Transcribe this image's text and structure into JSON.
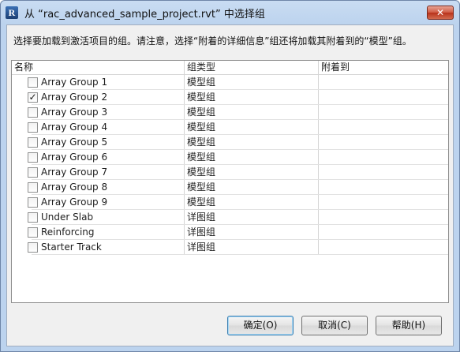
{
  "window": {
    "title": "从 “rac_advanced_sample_project.rvt” 中选择组",
    "app_icon_letter": "R",
    "close_glyph": "✕"
  },
  "instruction": "选择要加载到激活项目的组。请注意，选择“附着的详细信息”组还将加载其附着到的“模型”组。",
  "table": {
    "columns": [
      "名称",
      "组类型",
      "附着到"
    ],
    "rows": [
      {
        "name": "Array Group 1",
        "type": "模型组",
        "attached": "",
        "checked": false
      },
      {
        "name": "Array Group 2",
        "type": "模型组",
        "attached": "",
        "checked": true
      },
      {
        "name": "Array Group 3",
        "type": "模型组",
        "attached": "",
        "checked": false
      },
      {
        "name": "Array Group 4",
        "type": "模型组",
        "attached": "",
        "checked": false
      },
      {
        "name": "Array Group 5",
        "type": "模型组",
        "attached": "",
        "checked": false
      },
      {
        "name": "Array Group 6",
        "type": "模型组",
        "attached": "",
        "checked": false
      },
      {
        "name": "Array Group 7",
        "type": "模型组",
        "attached": "",
        "checked": false
      },
      {
        "name": "Array Group 8",
        "type": "模型组",
        "attached": "",
        "checked": false
      },
      {
        "name": "Array Group 9",
        "type": "模型组",
        "attached": "",
        "checked": false
      },
      {
        "name": "Under Slab",
        "type": "详图组",
        "attached": "",
        "checked": false
      },
      {
        "name": "Reinforcing",
        "type": "详图组",
        "attached": "",
        "checked": false
      },
      {
        "name": "Starter Track",
        "type": "详图组",
        "attached": "",
        "checked": false
      }
    ]
  },
  "buttons": {
    "ok": "确定(O)",
    "cancel": "取消(C)",
    "help": "帮助(H)"
  }
}
